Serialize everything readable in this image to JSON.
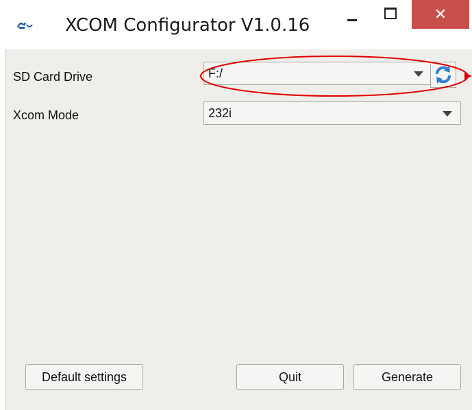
{
  "window": {
    "title": "XCOM Configurator V1.0.16",
    "close_glyph": "✕"
  },
  "form": {
    "sd_card_drive": {
      "label": "SD Card Drive",
      "value": "F:/"
    },
    "xcom_mode": {
      "label": "Xcom Mode",
      "value": "232i"
    }
  },
  "buttons": {
    "default_settings": "Default settings",
    "quit": "Quit",
    "generate": "Generate"
  },
  "icons": {
    "app": "app-logo-icon",
    "refresh": "refresh-icon",
    "minimize": "minimize-icon",
    "maximize": "maximize-icon",
    "close": "close-icon"
  },
  "colors": {
    "close_button": "#c7504b",
    "client_background": "#f0eeea",
    "annotation": "#e00000",
    "refresh_icon": "#2f7fd8"
  }
}
